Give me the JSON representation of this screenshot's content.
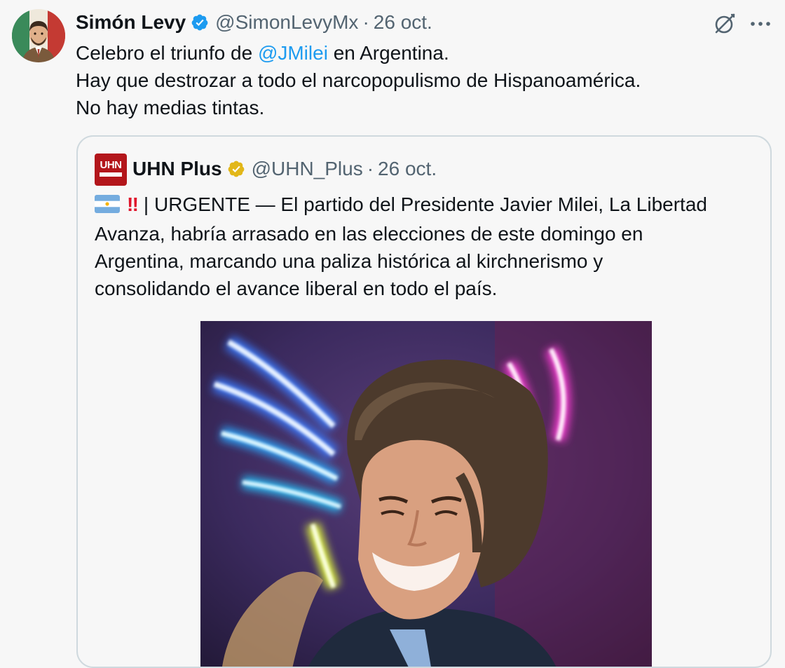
{
  "author": {
    "name": "Simón Levy",
    "handle": "@SimonLevyMx",
    "separator": "·",
    "date": "26 oct.",
    "verified_color": "#1d9bf0"
  },
  "tweet": {
    "line1_before": "Celebro el triunfo de ",
    "line1_mention": "@JMilei",
    "line1_after": " en Argentina.",
    "line2": "Hay que destrozar a todo el narcopopulismo de Hispanoamérica.",
    "line3": "No hay medias tintas."
  },
  "actions": {
    "grok_icon": "grok-icon",
    "more_icon": "more-icon"
  },
  "quote": {
    "name": "UHN Plus",
    "handle": "@UHN_Plus",
    "separator": "·",
    "date": "26 oct.",
    "verified_color": "#e2b719",
    "avatar_text": "UHN",
    "emoji_bang": "‼",
    "line1_rest": "| URGENTE — El partido del Presidente Javier Milei, La Libertad",
    "line2": "Avanza, habría arrasado en las elecciones de este domingo en",
    "line3": "Argentina, marcando una paliza histórica al kirchnerismo y",
    "line4": "consolidando el avance liberal en todo el país."
  },
  "colors": {
    "mention": "#1d9bf0",
    "secondary_text": "#536471",
    "border": "#cfd9de"
  }
}
